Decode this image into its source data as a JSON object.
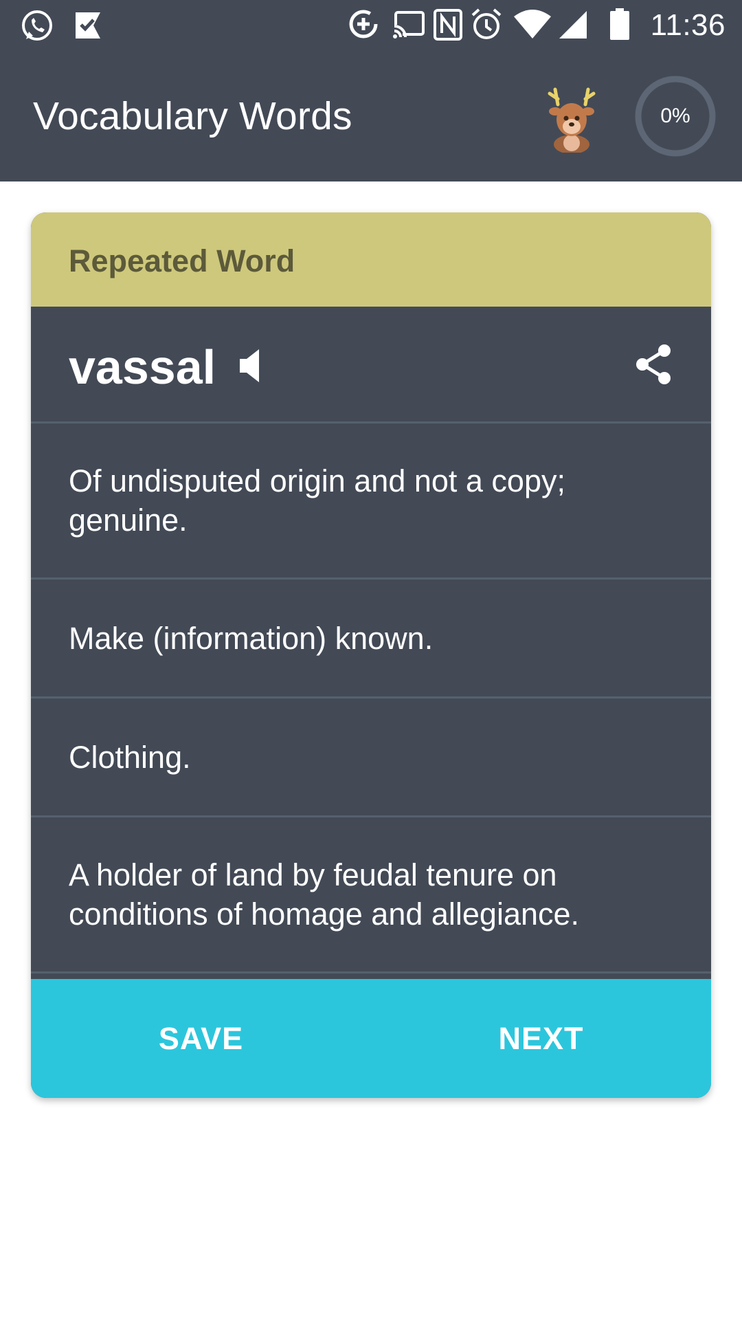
{
  "status_bar": {
    "time": "11:36",
    "icons": [
      "whatsapp-icon",
      "check-note-icon",
      "data-saver-icon",
      "cast-icon",
      "nfc-icon",
      "alarm-icon",
      "wifi-icon",
      "signal-icon",
      "battery-icon"
    ]
  },
  "app_bar": {
    "title": "Vocabulary Words",
    "mascot_icon": "deer-mascot-icon",
    "progress_label": "0%",
    "progress_value": 0
  },
  "card": {
    "header": "Repeated Word",
    "word": "vassal",
    "speaker_icon": "speaker-icon",
    "share_icon": "share-icon",
    "options": [
      "Of undisputed origin and not a copy; genuine.",
      "Make (information) known.",
      "Clothing.",
      "A holder of land by feudal tenure on conditions of homage and allegiance."
    ],
    "save_label": "SAVE",
    "next_label": "NEXT"
  },
  "colors": {
    "app_bar": "#434a56",
    "card_body": "#434a56",
    "header": "#cec87c",
    "action_bar": "#2cc6dc",
    "divider": "#56606e"
  }
}
